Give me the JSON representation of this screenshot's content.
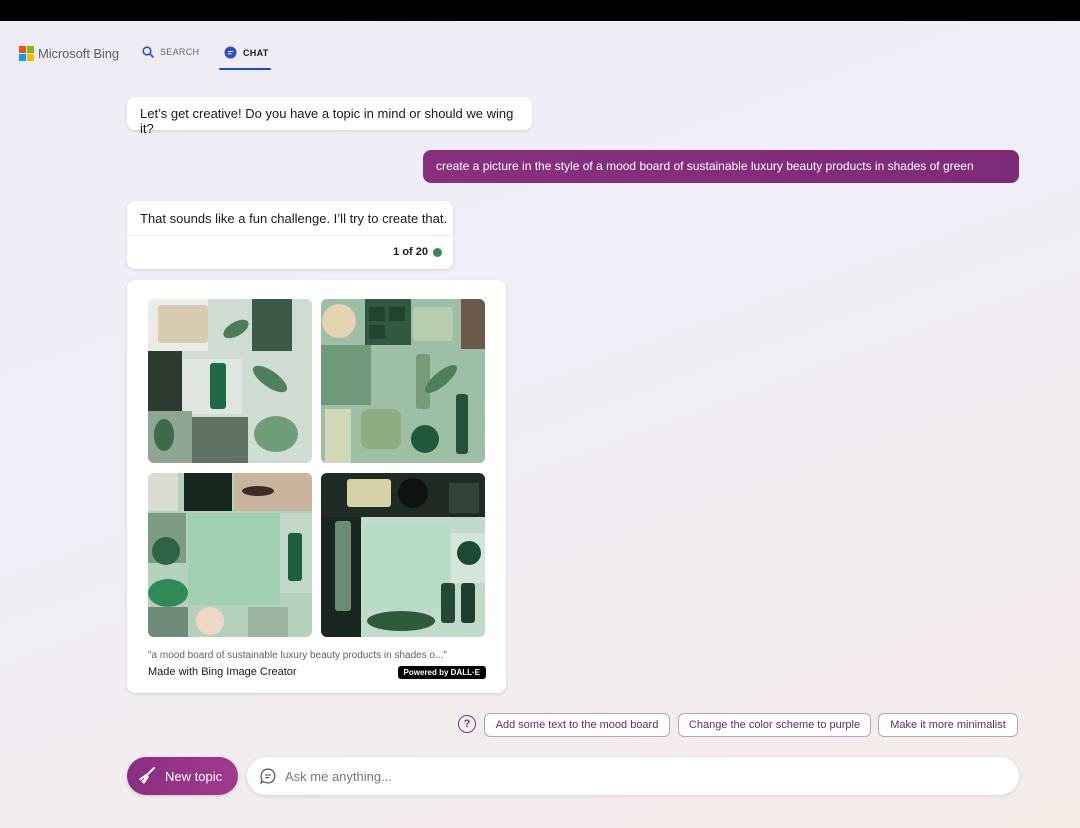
{
  "header": {
    "logo_text": "Microsoft Bing",
    "tabs": [
      {
        "label": "SEARCH",
        "icon": "search-icon"
      },
      {
        "label": "CHAT",
        "icon": "chat-icon",
        "active": true
      }
    ],
    "accent": "#174ae4"
  },
  "conversation": {
    "messages": [
      {
        "role": "bot",
        "text": "Let’s get creative! Do you have a topic in mind or should we wing it?"
      },
      {
        "role": "user",
        "text": "create a picture in the style of a mood board of sustainable luxury beauty products in shades of green"
      },
      {
        "role": "bot",
        "text": "That sounds like a fun challenge. I’ll try to create that.",
        "counter": "1 of 20"
      }
    ],
    "image_card": {
      "caption": "\"a mood board of sustainable luxury beauty products in shades o...\"",
      "made_with": "Made with Bing Image Creator",
      "badge": "Powered by DALL·E",
      "images": [
        "green mood board 1",
        "green mood board 2",
        "green mood board 3",
        "green mood board 4"
      ]
    }
  },
  "suggestions": {
    "help_icon": "?",
    "items": [
      "Add some text to the mood board",
      "Change the color scheme to purple",
      "Make it more minimalist"
    ]
  },
  "composer": {
    "new_topic_label": "New topic",
    "input_placeholder": "Ask me anything...",
    "input_value": ""
  },
  "colors": {
    "user_bubble": "#8a2f80",
    "status_dot": "#3a8a57"
  }
}
